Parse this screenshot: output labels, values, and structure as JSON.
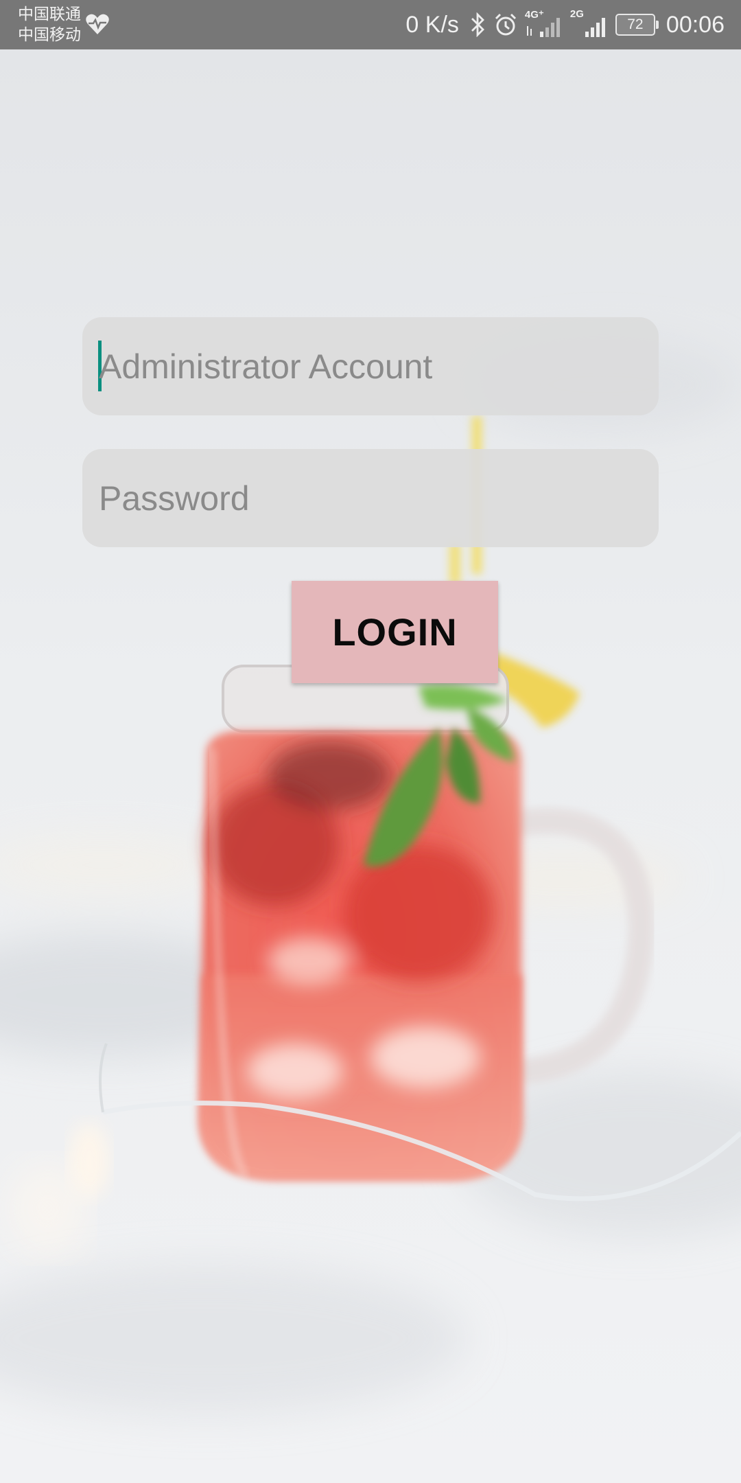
{
  "status_bar": {
    "carrier_1": "中国联通",
    "carrier_2": "中国移动",
    "network_speed": "0 K/s",
    "network_4g": "4G⁺",
    "network_2g": "2G",
    "battery": "72",
    "time": "00:06",
    "icons": [
      "heart-rate-icon",
      "bluetooth-icon",
      "alarm-icon",
      "signal-4g-icon",
      "signal-2g-icon",
      "battery-icon"
    ]
  },
  "login_form": {
    "account_placeholder": "Administrator Account",
    "account_value": "",
    "password_placeholder": "Password",
    "password_value": "",
    "login_label": "LOGIN"
  },
  "colors": {
    "status_bar_bg": "#777777",
    "field_bg": "#dcdcdc",
    "login_button_bg": "#e4b7ba",
    "caret": "#0a8f80",
    "placeholder": "#8a8a8a"
  },
  "background": {
    "description_icon": "strawberry-drink-jar-photo"
  }
}
